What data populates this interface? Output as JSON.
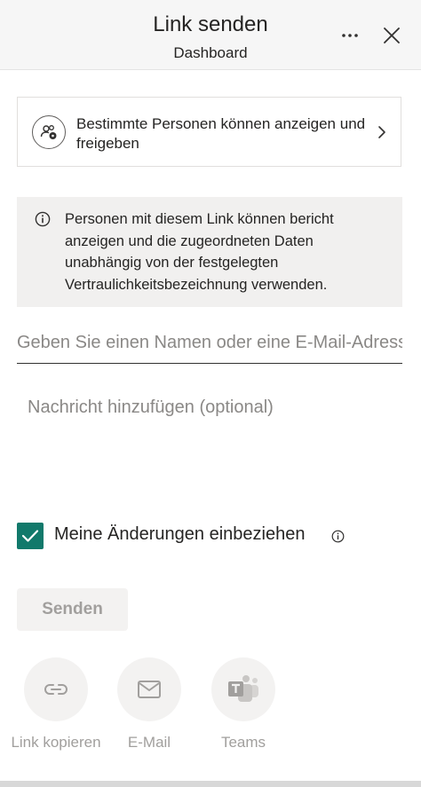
{
  "header": {
    "title": "Link senden",
    "subtitle": "Dashboard",
    "more_icon": "more-horizontal-icon",
    "close_icon": "close-icon"
  },
  "permissions": {
    "icon": "people-settings-icon",
    "label": "Bestimmte Personen können anzeigen und freigeben",
    "chevron_icon": "chevron-right-icon"
  },
  "info": {
    "icon": "info-icon",
    "text": "Personen mit diesem Link können bericht anzeigen und die zugeordneten Daten unabhängig von der festgelegten Vertraulichkeitsbezeichnung verwenden."
  },
  "recipient": {
    "placeholder": "Geben Sie einen Namen oder eine E-Mail-Adresse ein",
    "value": ""
  },
  "message": {
    "placeholder": "Nachricht hinzufügen (optional)",
    "value": ""
  },
  "include_changes": {
    "checked": true,
    "label": "Meine Änderungen einbeziehen",
    "info_icon": "info-icon"
  },
  "send": {
    "label": "Senden",
    "enabled": false
  },
  "share_options": [
    {
      "label": "Link kopieren",
      "icon": "link-icon"
    },
    {
      "label": "E-Mail",
      "icon": "mail-icon"
    },
    {
      "label": "Teams",
      "icon": "teams-icon"
    }
  ],
  "colors": {
    "accent": "#11796b",
    "disabled_text": "#a19f9d",
    "info_background": "#f1f0ef"
  }
}
